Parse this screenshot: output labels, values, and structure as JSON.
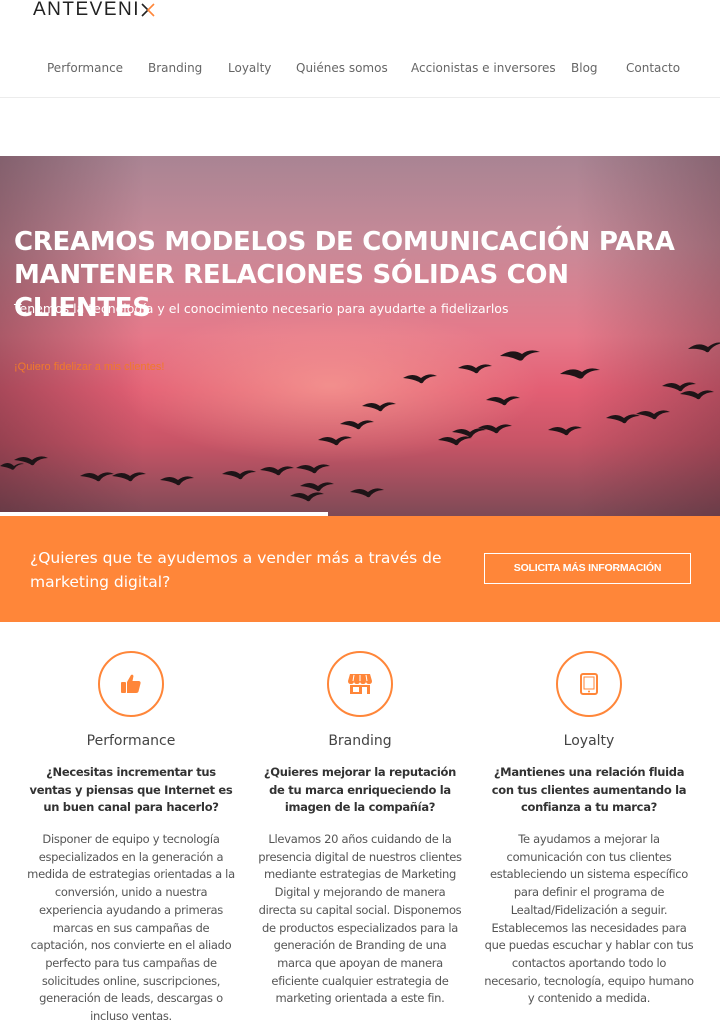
{
  "logo": {
    "text": "ANTEVENI",
    "mark": "x-mark-icon"
  },
  "nav": [
    {
      "label": "Performance"
    },
    {
      "label": "Branding"
    },
    {
      "label": "Loyalty"
    },
    {
      "label": "Quiénes somos"
    },
    {
      "label": "Accionistas e inversores"
    },
    {
      "label": "Blog"
    },
    {
      "label": "Contacto"
    }
  ],
  "hero": {
    "title_part1": "CREAMOS MODELOS DE ",
    "title_bold1": "COMUNICACIÓN",
    "title_part2": " PARA MANTENER RELACIONES SÓLIDAS ",
    "title_bold2": "CON CLIENTES",
    "subtitle": "Tenemos la tecnología y el conocimiento necesario para ayudarte a fidelizarlos",
    "link": "¡Quiero fidelizar a mis clientes!",
    "slider_progress": 0.456
  },
  "cta": {
    "text": "¿Quieres que te ayudemos a vender más a través de marketing digital?",
    "button": "SOLICITA MÁS INFORMACIÓN"
  },
  "features": [
    {
      "icon": "thumbs-up-icon",
      "title": "Performance",
      "question": "¿Necesitas incrementar tus ventas y piensas que Internet es un buen canal para hacerlo?",
      "body": "Disponer de equipo y tecnología especializados en la generación a medida de estrategias orientadas a la conversión, unido a nuestra experiencia ayudando a primeras marcas en sus campañas de captación, nos convierte en el aliado perfecto para tus campañas de solicitudes online, suscripciones, generación de leads, descargas o incluso ventas."
    },
    {
      "icon": "storefront-icon",
      "title": "Branding",
      "question": "¿Quieres mejorar la reputación de tu marca enriqueciendo la imagen de la compañía?",
      "body": "Llevamos 20 años cuidando de la presencia digital de nuestros clientes mediante estrategias de Marketing Digital y mejorando de manera directa su capital social. Disponemos de productos especializados para la generación de Branding de una marca que apoyan de manera eficiente cualquier estrategia de marketing orientada a este fin."
    },
    {
      "icon": "tablet-icon",
      "title": "Loyalty",
      "question": "¿Mantienes una relación fluida con tus clientes aumentando la confianza a tu marca?",
      "body": "Te ayudamos a mejorar la comunicación con tus clientes estableciendo un sistema específico para definir el programa de Lealtad/Fidelización a seguir. Establecemos las necesidades para que puedas escuchar y hablar con tus contactos aportando todo lo necesario, tecnología, equipo humano y contenido a medida."
    }
  ],
  "colors": {
    "accent": "#ff8639",
    "hero_link": "#f07a2a"
  }
}
